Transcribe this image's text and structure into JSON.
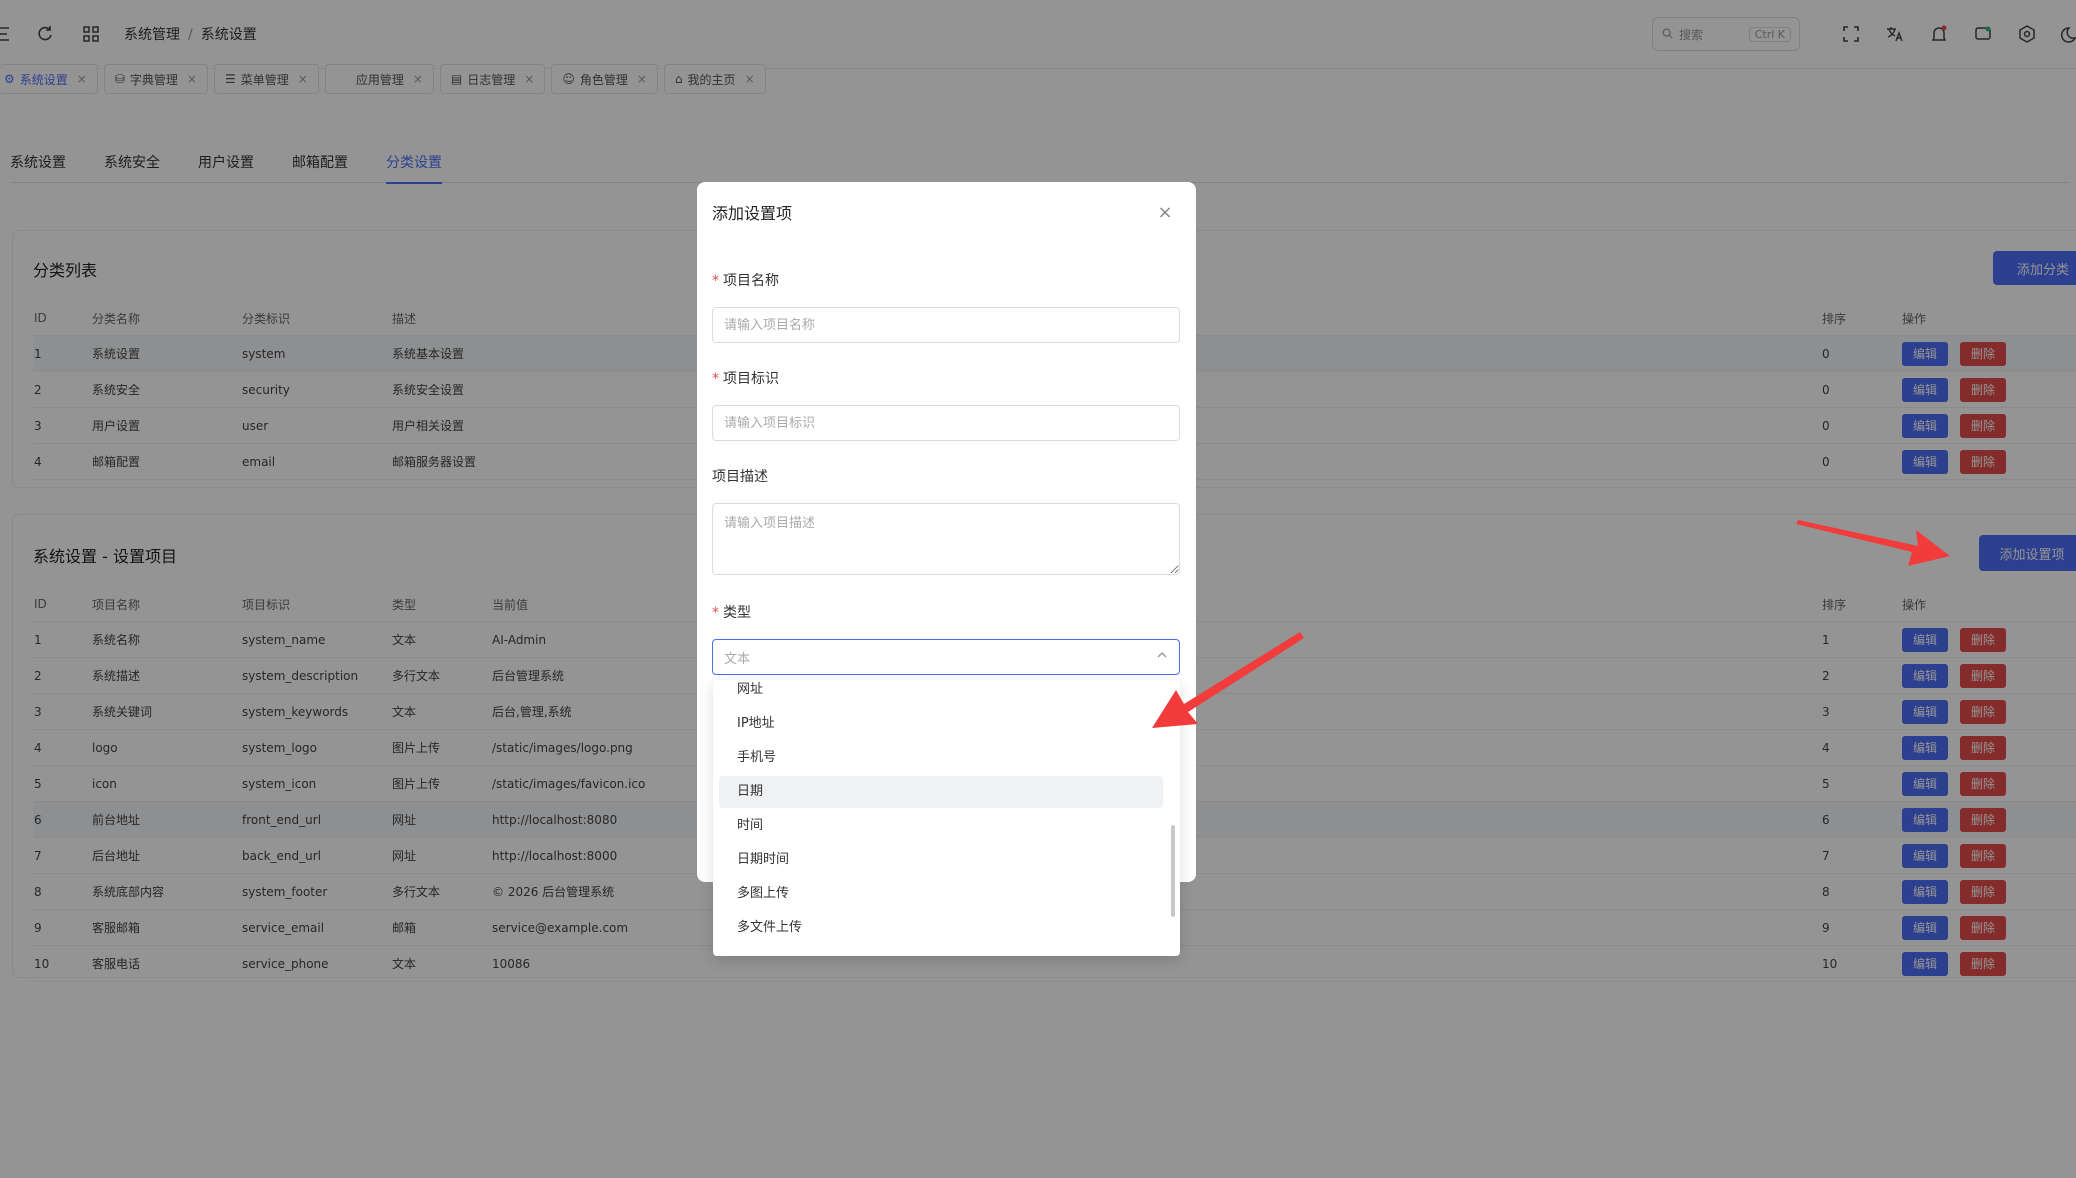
{
  "header": {
    "breadcrumb": [
      "系统管理",
      "系统设置"
    ],
    "search_placeholder": "搜索",
    "search_shortcut": "Ctrl K"
  },
  "tabs": [
    {
      "label": "系统设置",
      "icon": "gear-icon",
      "active": true
    },
    {
      "label": "字典管理",
      "icon": "database-icon"
    },
    {
      "label": "菜单管理",
      "icon": "menu-icon"
    },
    {
      "label": "应用管理",
      "icon": ""
    },
    {
      "label": "日志管理",
      "icon": "log-icon"
    },
    {
      "label": "角色管理",
      "icon": "user-icon"
    },
    {
      "label": "我的主页",
      "icon": "home-icon"
    }
  ],
  "subtabs": [
    "系统设置",
    "系统安全",
    "用户设置",
    "邮箱配置",
    "分类设置"
  ],
  "category_card": {
    "title": "分类列表",
    "add_button": "添加分类",
    "columns": [
      "ID",
      "分类名称",
      "分类标识",
      "描述",
      "排序",
      "操作"
    ],
    "rows": [
      [
        "1",
        "系统设置",
        "system",
        "系统基本设置",
        "0"
      ],
      [
        "2",
        "系统安全",
        "security",
        "系统安全设置",
        "0"
      ],
      [
        "3",
        "用户设置",
        "user",
        "用户相关设置",
        "0"
      ],
      [
        "4",
        "邮箱配置",
        "email",
        "邮箱服务器设置",
        "0"
      ]
    ]
  },
  "items_card": {
    "title": "系统设置 - 设置项目",
    "add_button": "添加设置项",
    "columns": [
      "ID",
      "项目名称",
      "项目标识",
      "类型",
      "当前值",
      "排序",
      "操作"
    ],
    "rows": [
      [
        "1",
        "系统名称",
        "system_name",
        "文本",
        "AI-Admin",
        "1"
      ],
      [
        "2",
        "系统描述",
        "system_description",
        "多行文本",
        "后台管理系统",
        "2"
      ],
      [
        "3",
        "系统关键词",
        "system_keywords",
        "文本",
        "后台,管理,系统",
        "3"
      ],
      [
        "4",
        "logo",
        "system_logo",
        "图片上传",
        "/static/images/logo.png",
        "4"
      ],
      [
        "5",
        "icon",
        "system_icon",
        "图片上传",
        "/static/images/favicon.ico",
        "5"
      ],
      [
        "6",
        "前台地址",
        "front_end_url",
        "网址",
        "http://localhost:8080",
        "6"
      ],
      [
        "7",
        "后台地址",
        "back_end_url",
        "网址",
        "http://localhost:8000",
        "7"
      ],
      [
        "8",
        "系统底部内容",
        "system_footer",
        "多行文本",
        "© 2026 后台管理系统",
        "8"
      ],
      [
        "9",
        "客服邮箱",
        "service_email",
        "邮箱",
        "service@example.com",
        "9"
      ],
      [
        "10",
        "客服电话",
        "service_phone",
        "文本",
        "10086",
        "10"
      ]
    ]
  },
  "actions": {
    "edit": "编辑",
    "delete": "删除"
  },
  "modal": {
    "title": "添加设置项",
    "name_label": "项目名称",
    "name_placeholder": "请输入项目名称",
    "key_label": "项目标识",
    "key_placeholder": "请输入项目标识",
    "desc_label": "项目描述",
    "desc_placeholder": "请输入项目描述",
    "type_label": "类型",
    "type_value": "文本"
  },
  "dropdown_options": [
    "网址",
    "IP地址",
    "手机号",
    "日期",
    "时间",
    "日期时间",
    "多图上传",
    "多文件上传"
  ],
  "dropdown_selected": "日期",
  "colors": {
    "accent": "#4f6ef7",
    "danger": "#e34d4d",
    "arrow": "#f23b3b"
  }
}
